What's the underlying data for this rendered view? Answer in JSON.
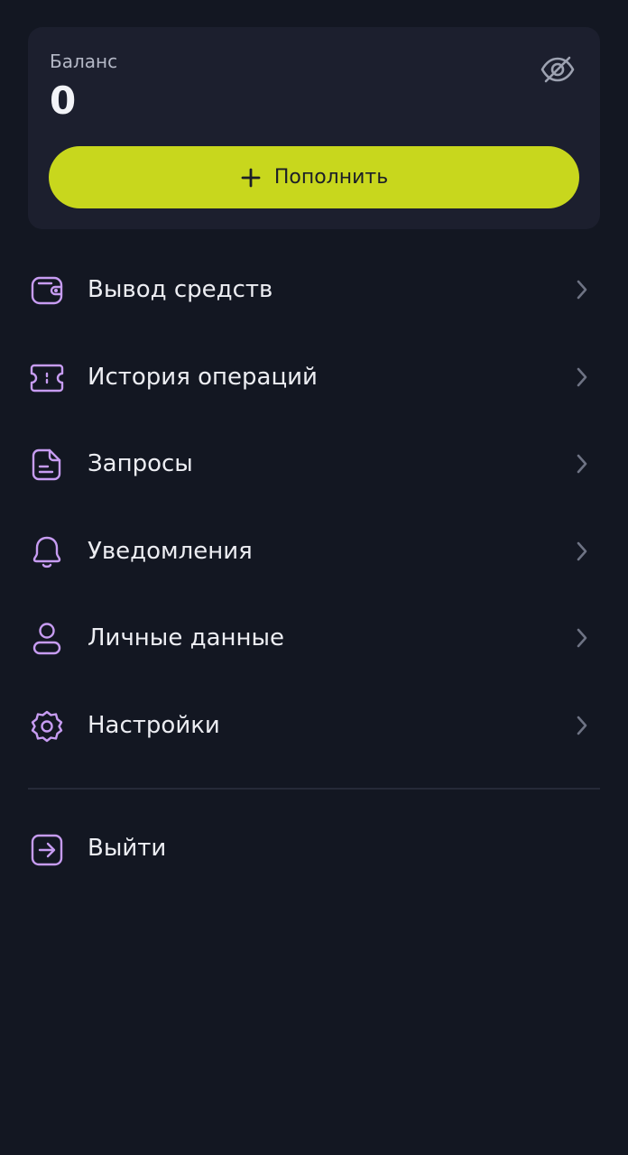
{
  "colors": {
    "background": "#131722",
    "card": "#1C1F2E",
    "accent": "#C8D71D",
    "icon": "#C79CF2",
    "chevron": "#6E7384",
    "text": "#ECEDF2"
  },
  "balance": {
    "label": "Баланс",
    "value": "0",
    "visibility_icon": "eye-off-icon",
    "topup_label": "Пополнить",
    "topup_icon": "plus-icon"
  },
  "menu": {
    "items": [
      {
        "label": "Вывод средств",
        "icon": "wallet-icon"
      },
      {
        "label": "История операций",
        "icon": "ticket-icon"
      },
      {
        "label": "Запросы",
        "icon": "document-icon"
      },
      {
        "label": "Уведомления",
        "icon": "bell-icon"
      },
      {
        "label": "Личные данные",
        "icon": "user-icon"
      },
      {
        "label": "Настройки",
        "icon": "gear-icon"
      }
    ]
  },
  "logout": {
    "label": "Выйти",
    "icon": "logout-icon"
  }
}
